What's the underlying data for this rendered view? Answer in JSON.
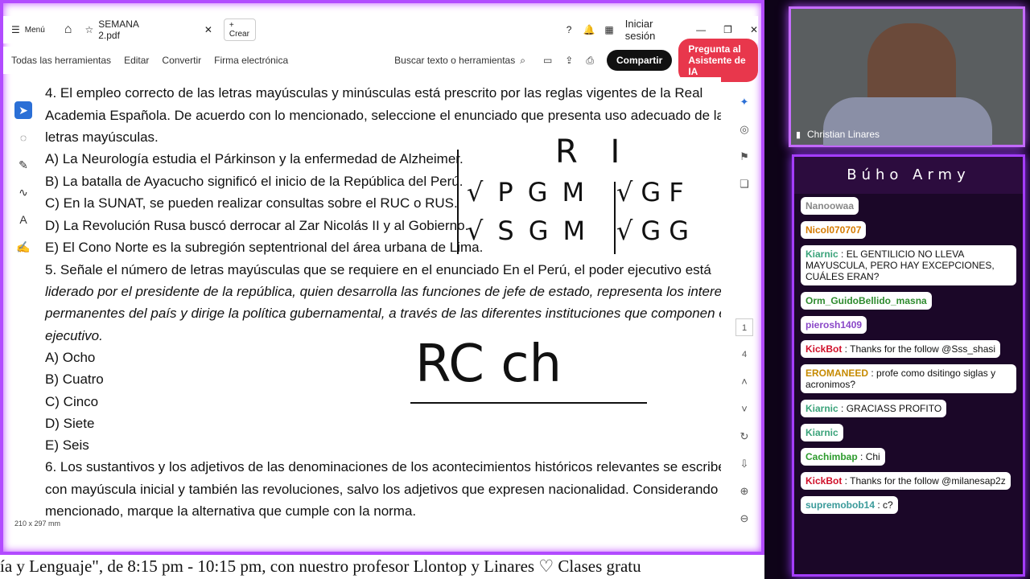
{
  "pdf": {
    "menu_label": "Menú",
    "tab_title": "SEMANA 2.pdf",
    "create_label": "+ Crear",
    "signin_label": "Iniciar sesión",
    "toolbar": [
      "Todas las herramientas",
      "Editar",
      "Convertir",
      "Firma electrónica"
    ],
    "search_label": "Buscar texto o herramientas",
    "share_label": "Compartir",
    "ai_label": "Pregunta al Asistente de IA",
    "page_size": "210 x 297 mm",
    "page_indicator_current": "1",
    "page_indicator_total": "4",
    "lines": [
      "4. El empleo correcto de las letras mayúsculas y minúsculas está prescrito por las reglas vigentes de la Real",
      "Academia Española. De acuerdo con lo mencionado, seleccione el enunciado que presenta uso adecuado de las",
      "letras mayúsculas.",
      "A) La Neurología estudia el Párkinson y la enfermedad de Alzheimer.",
      "B) La batalla de Ayacucho significó el inicio de la República del Perú.",
      "C) En la SUNAT, se pueden realizar consultas sobre el RUC o RUS.",
      "D) La Revolución Rusa buscó derrocar al Zar Nicolás II y al Gobierno.",
      "E) El Cono Norte es la subregión septentrional del área urbana de Lima.",
      "5. Señale el número de letras mayúsculas que se requiere en el enunciado En el Perú, el poder ejecutivo está",
      "liderado por el presidente de la república, quien desarrolla las funciones de jefe de estado, representa los intereses",
      "permanentes del país y dirige la política gubernamental, a través de las diferentes instituciones que componen el",
      "ejecutivo.",
      "A) Ocho",
      "B) Cuatro",
      "C) Cinco",
      "D) Siete",
      "E) Seis",
      "6. Los sustantivos y los adjetivos de las denominaciones de los acontecimientos históricos relevantes se escriben",
      "con mayúscula inicial y también las revoluciones, salvo los adjetivos que expresen nacionalidad. Considerando lo",
      "mencionado, marque la alternativa que cumple con la norma."
    ],
    "handwriting": [
      "R I",
      "√PGM",
      "√GF",
      "√SGM",
      "√GG",
      "RC ch"
    ]
  },
  "ticker": "ía y Lenguaje\", de 8:15 pm - 10:15 pm, con nuestro profesor Llontop y Linares ♡   Clases gratu",
  "cam": {
    "name": "Christian Linares"
  },
  "chat": {
    "title": "Búho Army",
    "messages": [
      {
        "user": "Nanoowaa",
        "text": ""
      },
      {
        "user": "Nicol070707",
        "text": ""
      },
      {
        "user": "Kiarnic",
        "text": "EL GENTILICIO NO LLEVA MAYUSCULA, PERO HAY EXCEPCIONES, CUÁLES ERAN?"
      },
      {
        "user": "Orm_GuidoBellido_masna",
        "text": ""
      },
      {
        "user": "pierosh1409",
        "text": ""
      },
      {
        "user": "KickBot",
        "text": "Thanks for the follow @Sss_shasi"
      },
      {
        "user": "EROMANEED",
        "text": "profe como dsitingo siglas y acronimos?"
      },
      {
        "user": "Kiarnic",
        "text": "GRACIASS PROFITO"
      },
      {
        "user": "Kiarnic",
        "text": ""
      },
      {
        "user": "Cachimbap",
        "text": "Chi"
      },
      {
        "user": "KickBot",
        "text": "Thanks for the follow @milanesap2z"
      },
      {
        "user": "supremobob14",
        "text": "c?"
      }
    ],
    "colors": {
      "kiarnic": "#3aa37a",
      "kickbot": "#d0102a",
      "nicol": "#d47a00",
      "orm": "#2e8b2e",
      "piero": "#8a48c8",
      "eroma": "#c68a00",
      "cachi": "#2e9b2e",
      "supremo": "#3a9a9a"
    }
  }
}
